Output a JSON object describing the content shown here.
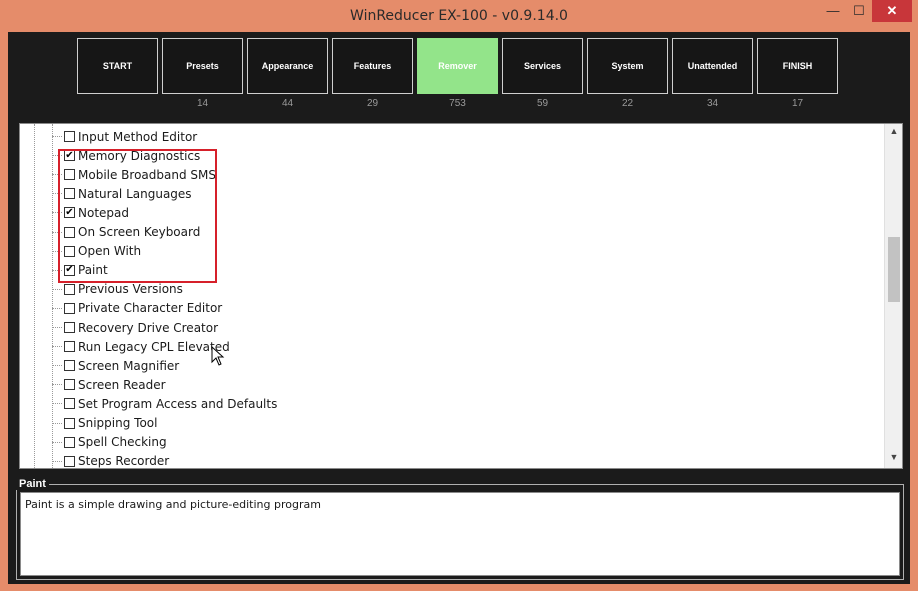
{
  "window": {
    "title": "WinReducer EX-100 - v0.9.14.0",
    "min_glyph": "—",
    "max_glyph": "☐",
    "close_glyph": "✕"
  },
  "tabs": [
    {
      "label": "START",
      "count": "",
      "active": false
    },
    {
      "label": "Presets",
      "count": "14",
      "active": false
    },
    {
      "label": "Appearance",
      "count": "44",
      "active": false
    },
    {
      "label": "Features",
      "count": "29",
      "active": false
    },
    {
      "label": "Remover",
      "count": "753",
      "active": true
    },
    {
      "label": "Services",
      "count": "59",
      "active": false
    },
    {
      "label": "System",
      "count": "22",
      "active": false
    },
    {
      "label": "Unattended",
      "count": "34",
      "active": false
    },
    {
      "label": "FINISH",
      "count": "17",
      "active": false
    }
  ],
  "tree": {
    "items": [
      {
        "label": "Input Method Editor",
        "checked": false
      },
      {
        "label": "Memory Diagnostics",
        "checked": true
      },
      {
        "label": "Mobile Broadband SMS",
        "checked": false
      },
      {
        "label": "Natural Languages",
        "checked": false
      },
      {
        "label": "Notepad",
        "checked": true
      },
      {
        "label": "On Screen Keyboard",
        "checked": false
      },
      {
        "label": "Open With",
        "checked": false
      },
      {
        "label": "Paint",
        "checked": true
      },
      {
        "label": "Previous Versions",
        "checked": false
      },
      {
        "label": "Private Character Editor",
        "checked": false
      },
      {
        "label": "Recovery Drive Creator",
        "checked": false
      },
      {
        "label": "Run Legacy CPL Elevated",
        "checked": false
      },
      {
        "label": "Screen Magnifier",
        "checked": false
      },
      {
        "label": "Screen Reader",
        "checked": false
      },
      {
        "label": "Set Program Access and Defaults",
        "checked": false
      },
      {
        "label": "Snipping Tool",
        "checked": false
      },
      {
        "label": "Spell Checking",
        "checked": false
      },
      {
        "label": "Steps Recorder",
        "checked": false
      }
    ]
  },
  "description": {
    "title": "Paint",
    "text": "Paint is a simple drawing and picture-editing program"
  },
  "colors": {
    "frame": "#e58c6a",
    "content_bg": "#1b1b1b",
    "active_tab": "#93e48a",
    "close_button": "#c8363a",
    "highlight_box": "#d6202a"
  },
  "icons": {
    "checkmark": "✔",
    "scroll_up": "▲",
    "scroll_down": "▼"
  }
}
